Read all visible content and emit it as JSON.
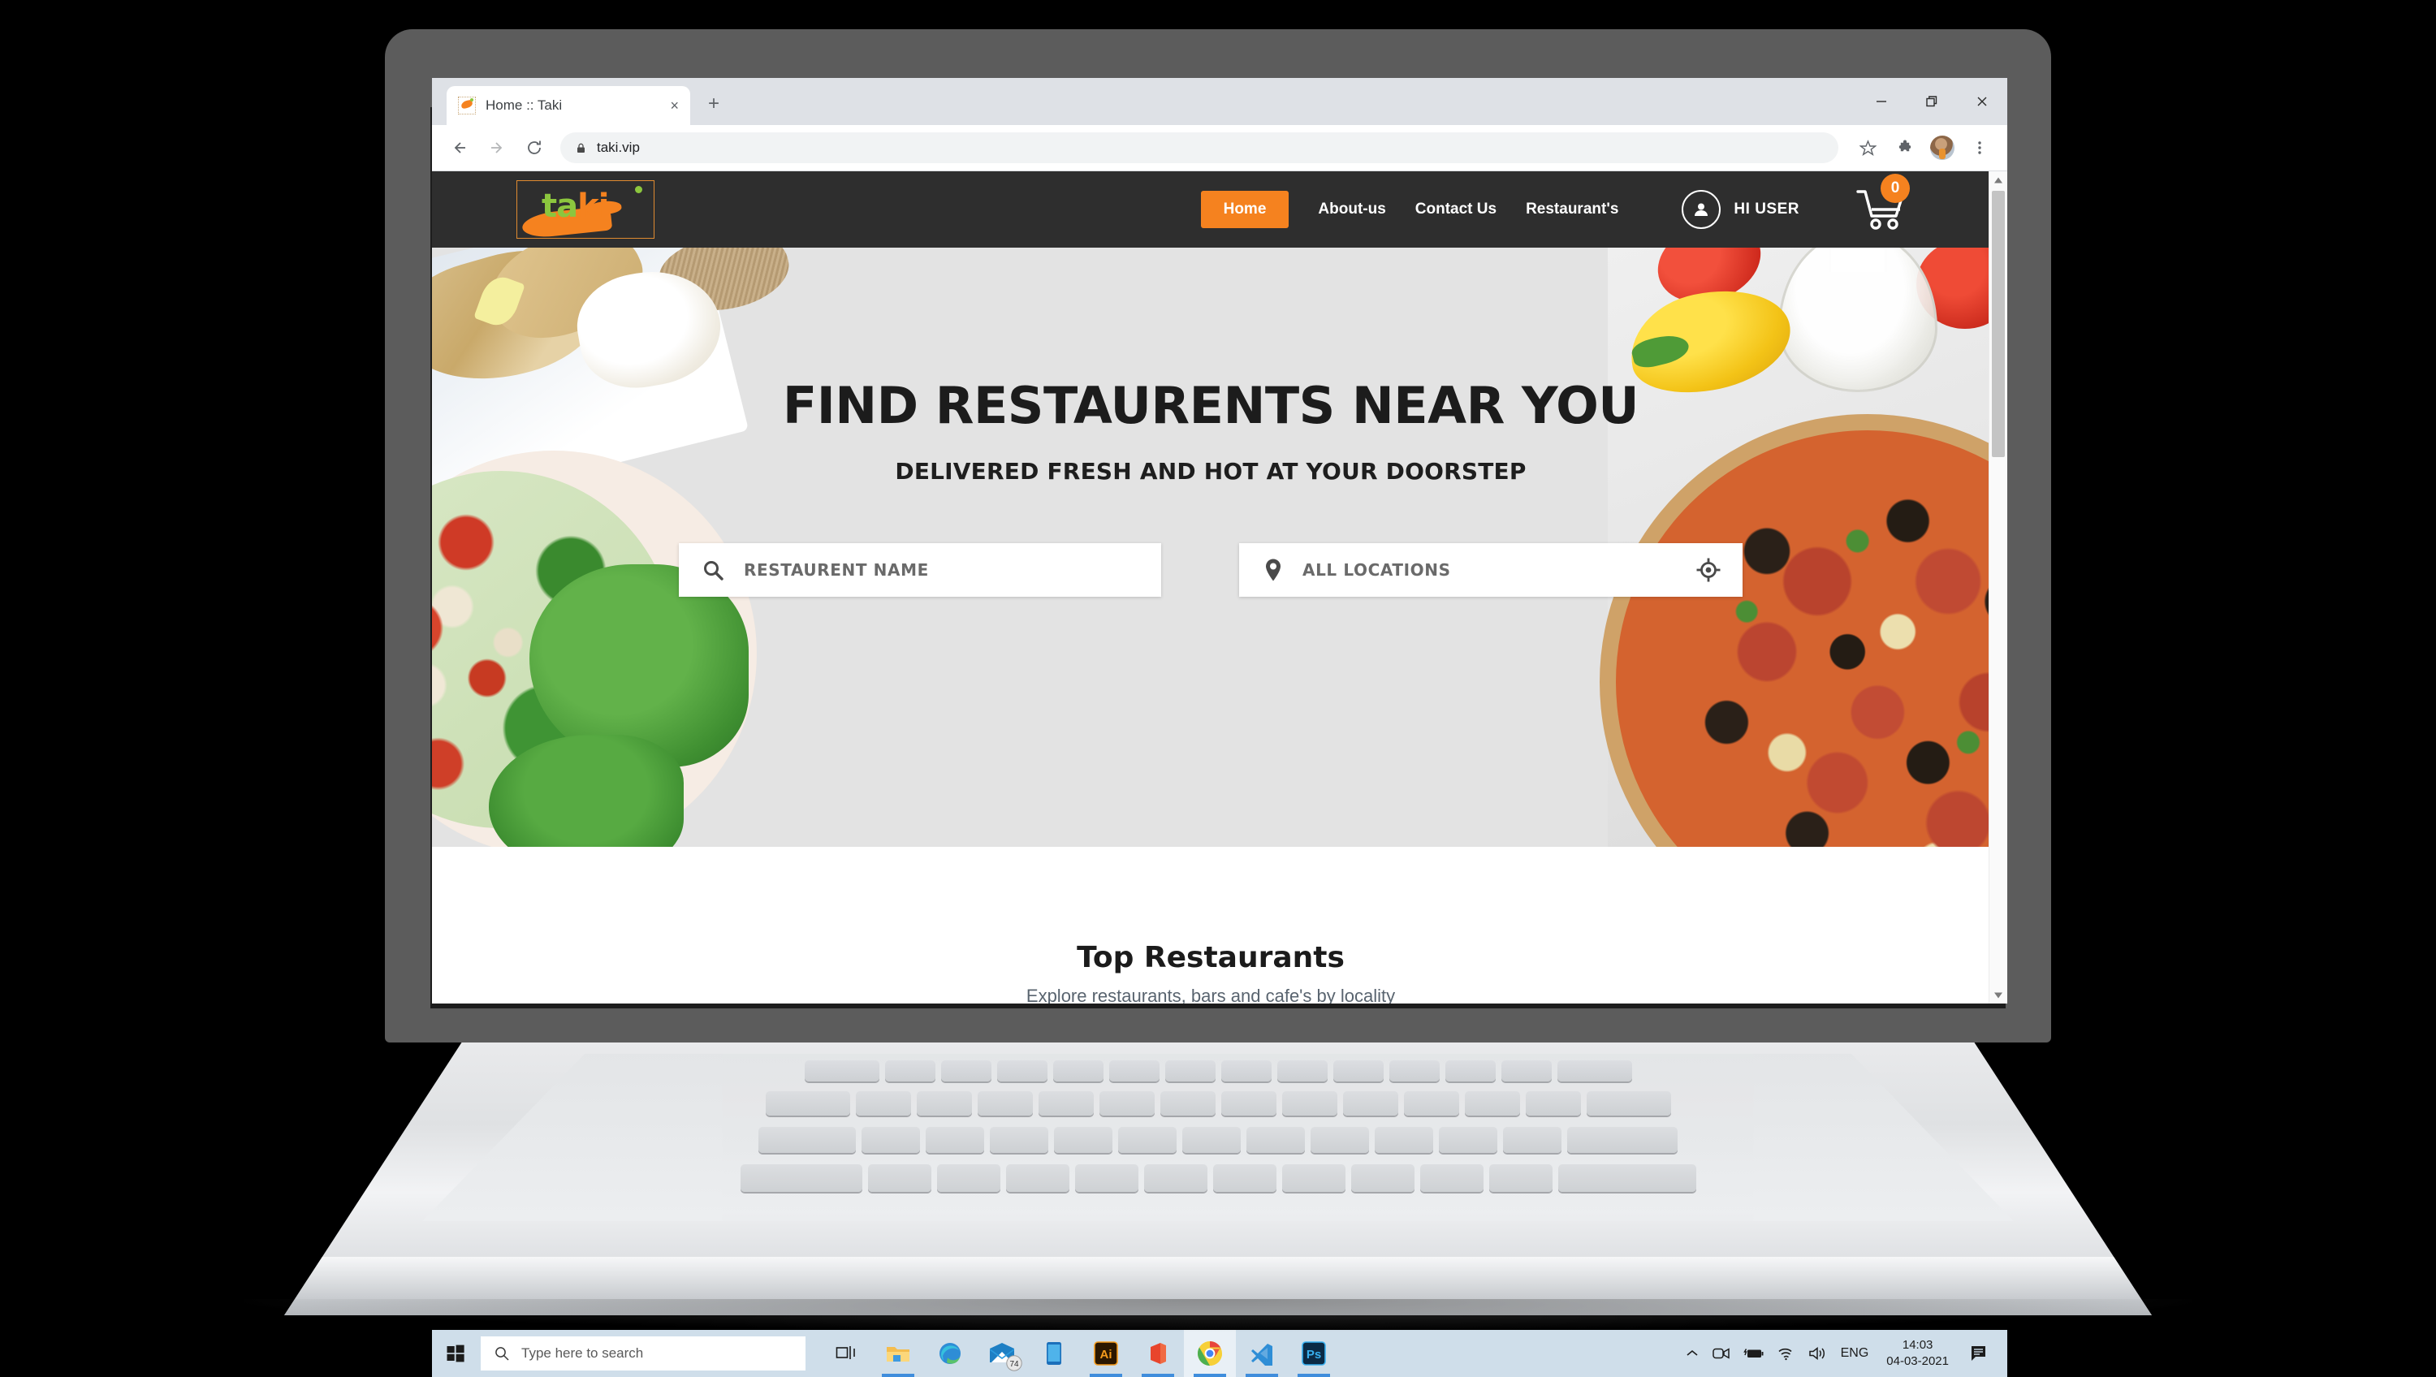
{
  "browser": {
    "tab": {
      "title": "Home :: Taki",
      "favicon": "taki-favicon",
      "close": "×"
    },
    "new_tab": "+",
    "window_controls": {
      "minimize": "—",
      "restore": "❐",
      "close": "✕"
    },
    "toolbar": {
      "back": "←",
      "forward": "→",
      "reload": "⟳",
      "lock": "lock-icon",
      "url": "taki.vip",
      "bookmark": "☆",
      "extensions": "puzzle-icon",
      "profile": "profile-avatar",
      "menu": "⋮"
    },
    "scrollbar": {
      "up": "▲",
      "down": "▼"
    }
  },
  "site": {
    "logo": {
      "text_green": "ta",
      "text_orange": "ki",
      "alt": "taki-logo"
    },
    "nav": [
      {
        "label": "Home",
        "active": true
      },
      {
        "label": "About-us",
        "active": false
      },
      {
        "label": "Contact Us",
        "active": false
      },
      {
        "label": "Restaurant's",
        "active": false
      }
    ],
    "user": {
      "greeting": "HI USER",
      "icon": "user-circle-icon"
    },
    "cart": {
      "count": "0",
      "icon": "shopping-cart-icon"
    },
    "hero": {
      "heading": "FIND RESTAURENTS NEAR YOU",
      "subheading": "DELIVERED FRESH AND HOT AT YOUR DOORSTEP",
      "search_name": {
        "placeholder": "RESTAURENT NAME",
        "icon": "search-icon",
        "value": ""
      },
      "search_location": {
        "placeholder": "ALL LOCATIONS",
        "icon": "map-pin-icon",
        "gps_icon": "crosshair-icon",
        "value": ""
      }
    },
    "top_restaurants": {
      "title": "Top Restaurants",
      "subtitle": "Explore restaurants, bars and cafe's by locality"
    }
  },
  "taskbar": {
    "start": "windows-start-icon",
    "search_placeholder": "Type here to search",
    "apps": [
      {
        "name": "task-view",
        "label": "Task View"
      },
      {
        "name": "file-explorer",
        "label": "File Explorer"
      },
      {
        "name": "microsoft-edge",
        "label": "Microsoft Edge"
      },
      {
        "name": "mail",
        "label": "Mail",
        "badge": "74"
      },
      {
        "name": "your-phone",
        "label": "Your Phone"
      },
      {
        "name": "adobe-illustrator",
        "label": "Ai"
      },
      {
        "name": "microsoft-office",
        "label": "Office"
      },
      {
        "name": "google-chrome",
        "label": "Google Chrome",
        "active": true
      },
      {
        "name": "visual-studio-code",
        "label": "Visual Studio Code"
      },
      {
        "name": "adobe-photoshop",
        "label": "Ps"
      }
    ],
    "tray": {
      "chevron": "˄",
      "camera": "camera-icon",
      "battery": "battery-charging-icon",
      "wifi": "wifi-icon",
      "volume": "volume-icon",
      "language": "ENG",
      "time": "14:03",
      "date": "04-03-2021",
      "action_center": "action-center-icon"
    }
  },
  "colors": {
    "brand_orange": "#f5821f",
    "brand_green": "#8cc63e",
    "header_dark": "#2e2e2e",
    "hero_bg": "#e3e3e3",
    "taskbar": "#cfdeea"
  }
}
